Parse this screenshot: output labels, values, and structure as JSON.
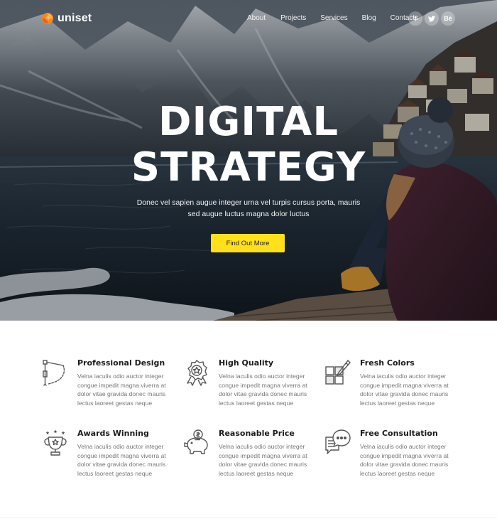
{
  "brand": {
    "name": "uniset",
    "accent": "#ffe01b",
    "logo_color": "#f5871f"
  },
  "nav": {
    "items": [
      "About",
      "Projects",
      "Services",
      "Blog",
      "Contacts"
    ],
    "socials": [
      {
        "icon": "facebook-icon",
        "glyph": "f"
      },
      {
        "icon": "twitter-icon",
        "glyph": "🐦"
      },
      {
        "icon": "behance-icon",
        "glyph": "Bē"
      }
    ]
  },
  "hero": {
    "title_line1": "DIGITAL",
    "title_line2": "STRATEGY",
    "subtitle": "Donec vel sapien augue integer urna vel turpis cursus porta, mauris sed augue luctus magna dolor luctus",
    "cta_label": "Find Out More"
  },
  "features": [
    {
      "title": "Professional Design",
      "icon": "compass-icon",
      "text": "Velna iaculis odio auctor integer congue impedit magna viverra at dolor vitae gravida donec mauris lectus laoreet gestas neque"
    },
    {
      "title": "High Quality",
      "icon": "award-badge-icon",
      "text": "Velna iaculis odio auctor integer congue impedit magna viverra at dolor vitae gravida donec mauris lectus laoreet gestas neque"
    },
    {
      "title": "Fresh Colors",
      "icon": "palette-brush-icon",
      "text": "Velna iaculis odio auctor integer congue impedit magna viverra at dolor vitae gravida donec mauris lectus laoreet gestas neque"
    },
    {
      "title": "Awards Winning",
      "icon": "trophy-icon",
      "text": "Velna iaculis odio auctor integer congue impedit magna viverra at dolor vitae gravida donec mauris lectus laoreet gestas neque"
    },
    {
      "title": "Reasonable Price",
      "icon": "piggy-bank-icon",
      "text": "Velna iaculis odio auctor integer congue impedit magna viverra at dolor vitae gravida donec mauris lectus laoreet gestas neque"
    },
    {
      "title": "Free Consultation",
      "icon": "chat-bubbles-icon",
      "text": "Velna iaculis odio auctor integer congue impedit magna viverra at dolor vitae gravida donec mauris lectus laoreet gestas neque"
    }
  ]
}
